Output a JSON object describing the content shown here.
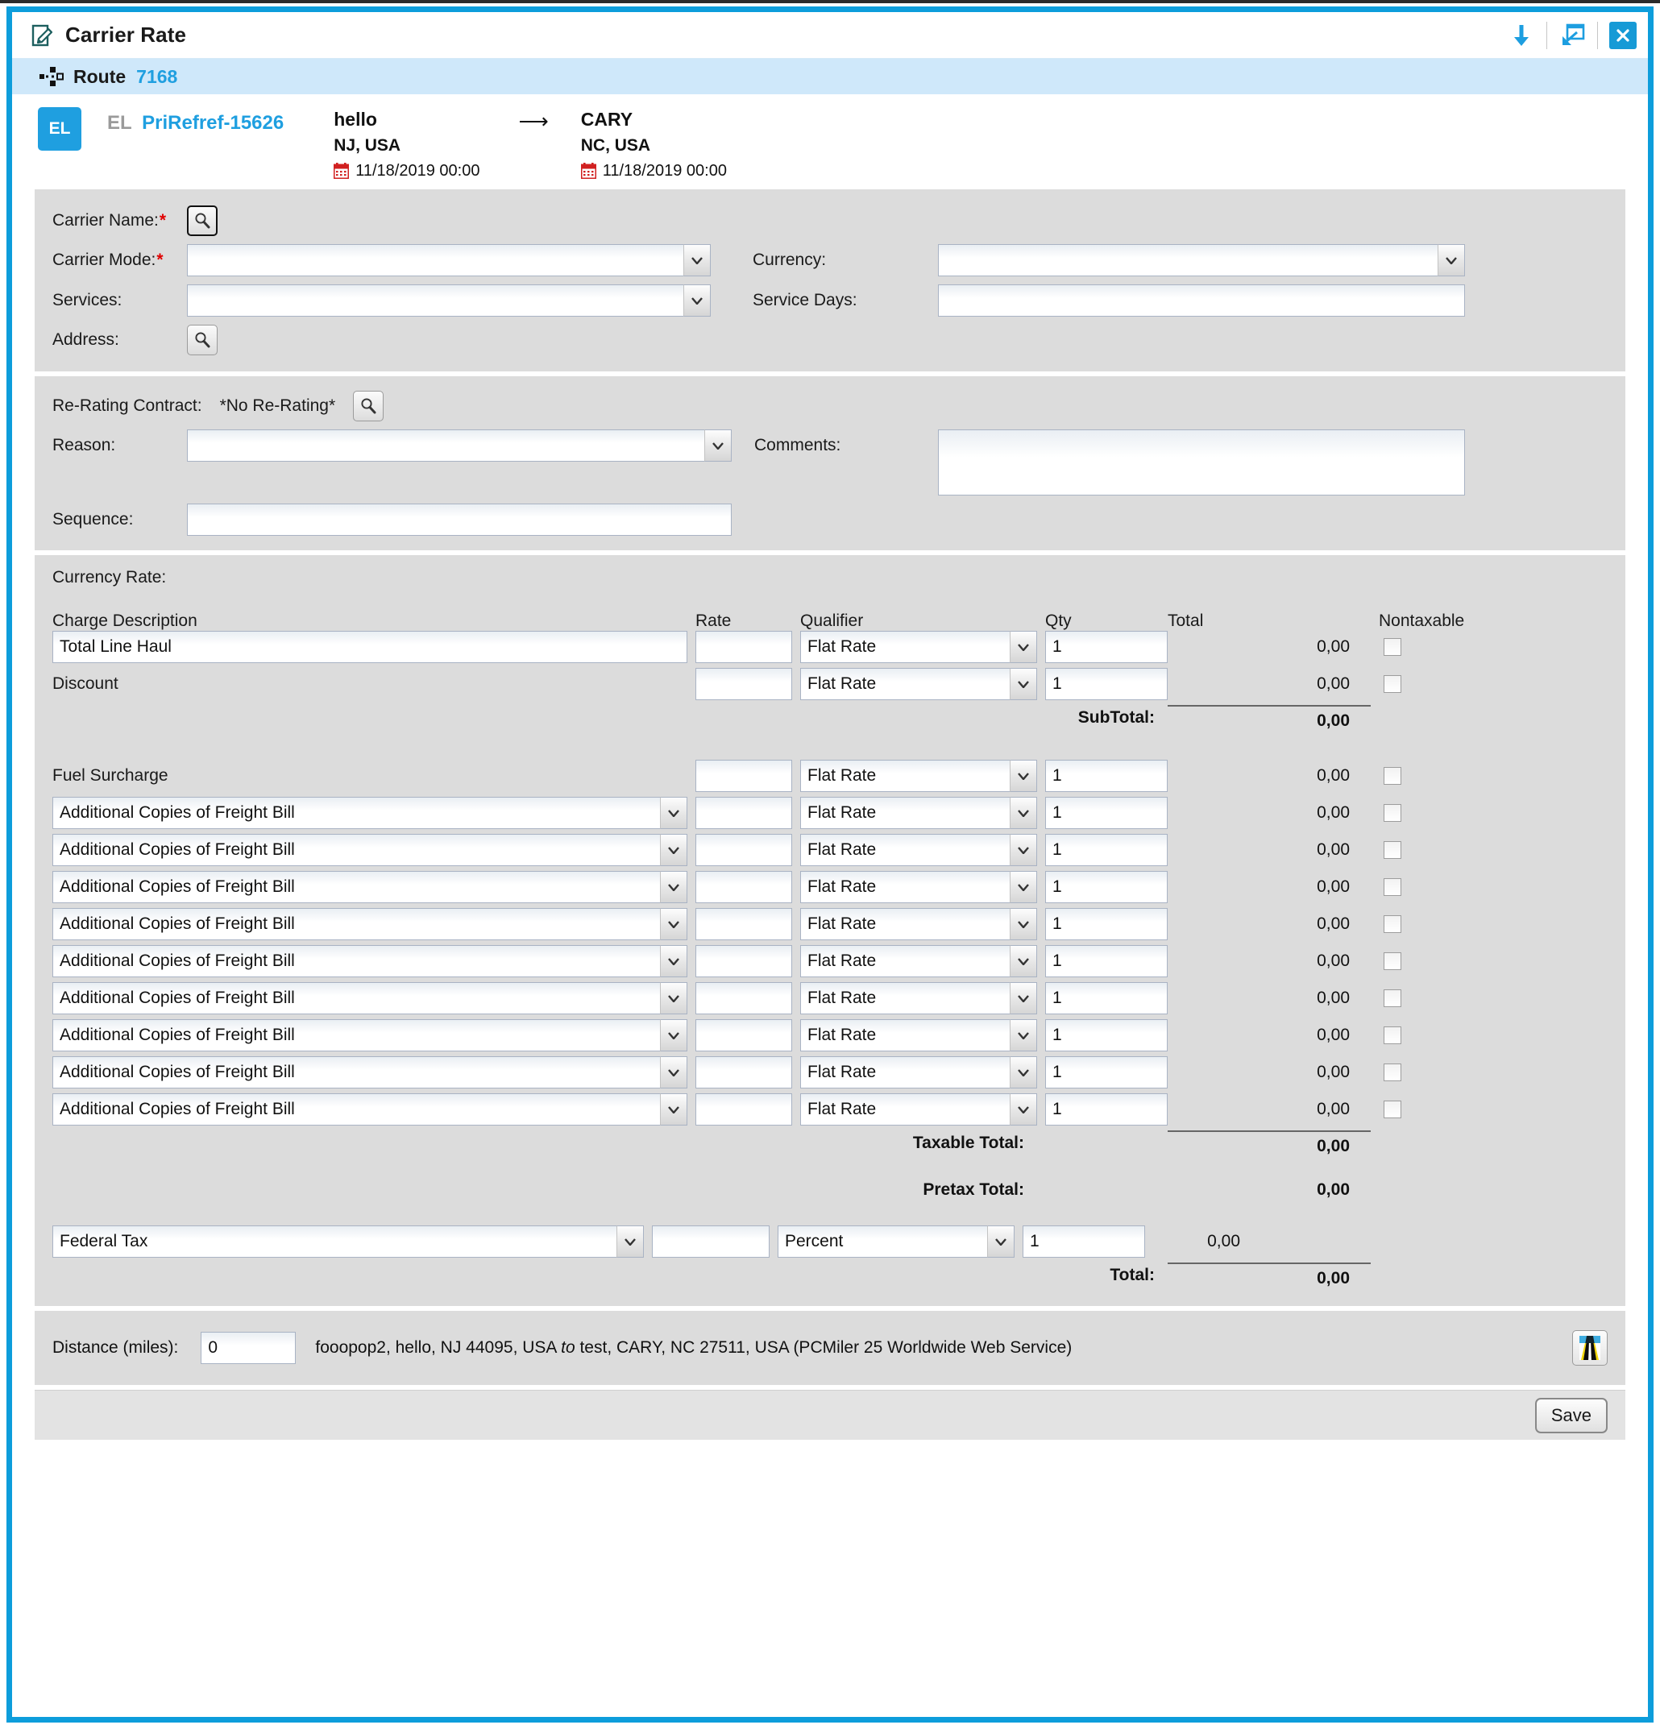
{
  "window": {
    "title": "Carrier Rate",
    "title_icon": "edit-document-icon",
    "actions": [
      {
        "name": "download-icon",
        "glyph": "arrow-down"
      },
      {
        "name": "popout-icon",
        "glyph": "open-in-window"
      },
      {
        "name": "close-icon",
        "glyph": "x"
      }
    ]
  },
  "route": {
    "icon": "route-nodes-icon",
    "label": "Route",
    "number": "7168"
  },
  "shipment": {
    "badge": "EL",
    "prefix": "EL",
    "reference": "PriRefref-15626",
    "origin": {
      "city": "hello",
      "region": "NJ, USA",
      "date": "11/18/2019 00:00"
    },
    "destination": {
      "city": "CARY",
      "region": "NC, USA",
      "date": "11/18/2019 00:00"
    }
  },
  "carrier_panel": {
    "carrier_name_label": "Carrier Name:",
    "carrier_mode_label": "Carrier Mode:",
    "services_label": "Services:",
    "address_label": "Address:",
    "currency_label": "Currency:",
    "service_days_label": "Service Days:",
    "carrier_mode_value": "",
    "services_value": "",
    "currency_value": "",
    "service_days_value": ""
  },
  "rerating_panel": {
    "contract_label": "Re-Rating Contract:",
    "contract_value": "*No Re-Rating*",
    "reason_label": "Reason:",
    "reason_value": "",
    "sequence_label": "Sequence:",
    "sequence_value": "",
    "comments_label": "Comments:",
    "comments_value": ""
  },
  "currency_rate": {
    "section_label": "Currency Rate:",
    "headers": {
      "description": "Charge Description",
      "rate": "Rate",
      "qualifier": "Qualifier",
      "qty": "Qty",
      "total": "Total",
      "nontaxable": "Nontaxable"
    },
    "rows_top": [
      {
        "desc": "Total Line Haul",
        "desc_type": "input",
        "rate": "",
        "qualifier": "Flat Rate",
        "qty": "1",
        "total": "0,00",
        "nontaxable": false
      },
      {
        "desc": "Discount",
        "desc_type": "static",
        "rate": "",
        "qualifier": "Flat Rate",
        "qty": "1",
        "total": "0,00",
        "nontaxable": false
      }
    ],
    "subtotal_label": "SubTotal:",
    "subtotal_value": "0,00",
    "rows_mid": [
      {
        "desc": "Fuel Surcharge",
        "desc_type": "static",
        "rate": "",
        "qualifier": "Flat Rate",
        "qty": "1",
        "total": "0,00",
        "nontaxable": false
      },
      {
        "desc": "Additional Copies of Freight Bill",
        "desc_type": "select",
        "rate": "",
        "qualifier": "Flat Rate",
        "qty": "1",
        "total": "0,00",
        "nontaxable": false
      },
      {
        "desc": "Additional Copies of Freight Bill",
        "desc_type": "select",
        "rate": "",
        "qualifier": "Flat Rate",
        "qty": "1",
        "total": "0,00",
        "nontaxable": false
      },
      {
        "desc": "Additional Copies of Freight Bill",
        "desc_type": "select",
        "rate": "",
        "qualifier": "Flat Rate",
        "qty": "1",
        "total": "0,00",
        "nontaxable": false
      },
      {
        "desc": "Additional Copies of Freight Bill",
        "desc_type": "select",
        "rate": "",
        "qualifier": "Flat Rate",
        "qty": "1",
        "total": "0,00",
        "nontaxable": false
      },
      {
        "desc": "Additional Copies of Freight Bill",
        "desc_type": "select",
        "rate": "",
        "qualifier": "Flat Rate",
        "qty": "1",
        "total": "0,00",
        "nontaxable": false
      },
      {
        "desc": "Additional Copies of Freight Bill",
        "desc_type": "select",
        "rate": "",
        "qualifier": "Flat Rate",
        "qty": "1",
        "total": "0,00",
        "nontaxable": false
      },
      {
        "desc": "Additional Copies of Freight Bill",
        "desc_type": "select",
        "rate": "",
        "qualifier": "Flat Rate",
        "qty": "1",
        "total": "0,00",
        "nontaxable": false
      },
      {
        "desc": "Additional Copies of Freight Bill",
        "desc_type": "select",
        "rate": "",
        "qualifier": "Flat Rate",
        "qty": "1",
        "total": "0,00",
        "nontaxable": false
      },
      {
        "desc": "Additional Copies of Freight Bill",
        "desc_type": "select",
        "rate": "",
        "qualifier": "Flat Rate",
        "qty": "1",
        "total": "0,00",
        "nontaxable": false
      }
    ],
    "taxable_total_label": "Taxable Total:",
    "taxable_total_value": "0,00",
    "pretax_total_label": "Pretax Total:",
    "pretax_total_value": "0,00",
    "tax_row": {
      "desc": "Federal Tax",
      "rate": "",
      "qualifier": "Percent",
      "qty": "1",
      "total": "0,00"
    },
    "total_label": "Total:",
    "total_value": "0,00"
  },
  "distance": {
    "label": "Distance (miles):",
    "value": "0",
    "origin_text": "fooopop2, hello, NJ 44095, USA",
    "connector": "to",
    "dest_text": "test, CARY, NC 27511, USA (PCMiler 25 Worldwide Web Service)",
    "map_icon": "road-map-icon"
  },
  "footer": {
    "save_label": "Save"
  },
  "colors": {
    "accent": "#1f9fe0",
    "frame": "#0d9ddb",
    "routebar": "#cfe8fa",
    "panel": "#dcdcdc",
    "required": "#e00000"
  }
}
